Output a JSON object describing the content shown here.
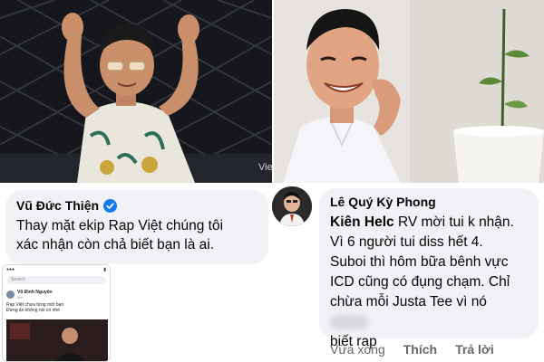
{
  "photos": {
    "left_watermark": "Vie"
  },
  "comment_left": {
    "author": "Vũ Đức Thiện",
    "line1": "Thay mặt ekip Rap Việt chúng tôi",
    "line2": "xác nhận còn chả biết bạn là ai."
  },
  "comment_right": {
    "author": "Lê Quý Kỳ Phong",
    "mention": "Kiên Helc",
    "line1_rest": " RV mời tui k nhận.",
    "line2": "Vì  6 người tui diss hết 4.",
    "line3": "Suboi thì hôm bữa bênh vực",
    "line4": "ICD cũng có đụng chạm. Chỉ",
    "line5": "chừa mỗi Justa Tee vì nó",
    "line6": "biết rap",
    "actions": [
      "Vừa xong",
      "Thích",
      "Trả lời"
    ]
  },
  "phone_screenshot": {
    "search_placeholder": "Search",
    "post_author": "Vũ Đình Nguyên",
    "post_time": "5m",
    "post_line1": "Rap Việt chưa từng mời bạn",
    "post_line2": "Đừng ăn không nói có nhé"
  }
}
